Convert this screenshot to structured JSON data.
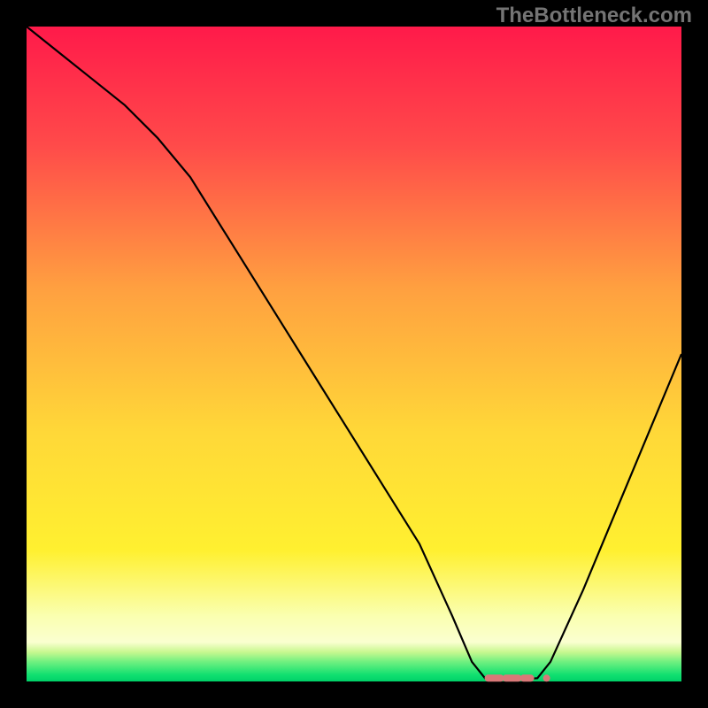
{
  "watermark": "TheBottleneck.com",
  "chart_data": {
    "type": "line",
    "title": "",
    "xlabel": "",
    "ylabel": "",
    "xlim": [
      0,
      100
    ],
    "ylim": [
      0,
      100
    ],
    "x": [
      0,
      5,
      10,
      15,
      20,
      25,
      30,
      35,
      40,
      45,
      50,
      55,
      60,
      65,
      68,
      70,
      72,
      75,
      78,
      80,
      85,
      90,
      95,
      100
    ],
    "y": [
      100,
      96,
      92,
      88,
      83,
      77,
      69,
      61,
      53,
      45,
      37,
      29,
      21,
      10,
      3,
      0.5,
      0.3,
      0.3,
      0.5,
      3,
      14,
      26,
      38,
      50
    ],
    "marker": {
      "x": 74,
      "y": 0.5,
      "color": "#d97878"
    },
    "background_gradient": {
      "top": "#ff1a4a",
      "mid1": "#ffa040",
      "mid2": "#fff030",
      "bottom_band": "#faffb0",
      "green_band": "#10e070"
    }
  }
}
